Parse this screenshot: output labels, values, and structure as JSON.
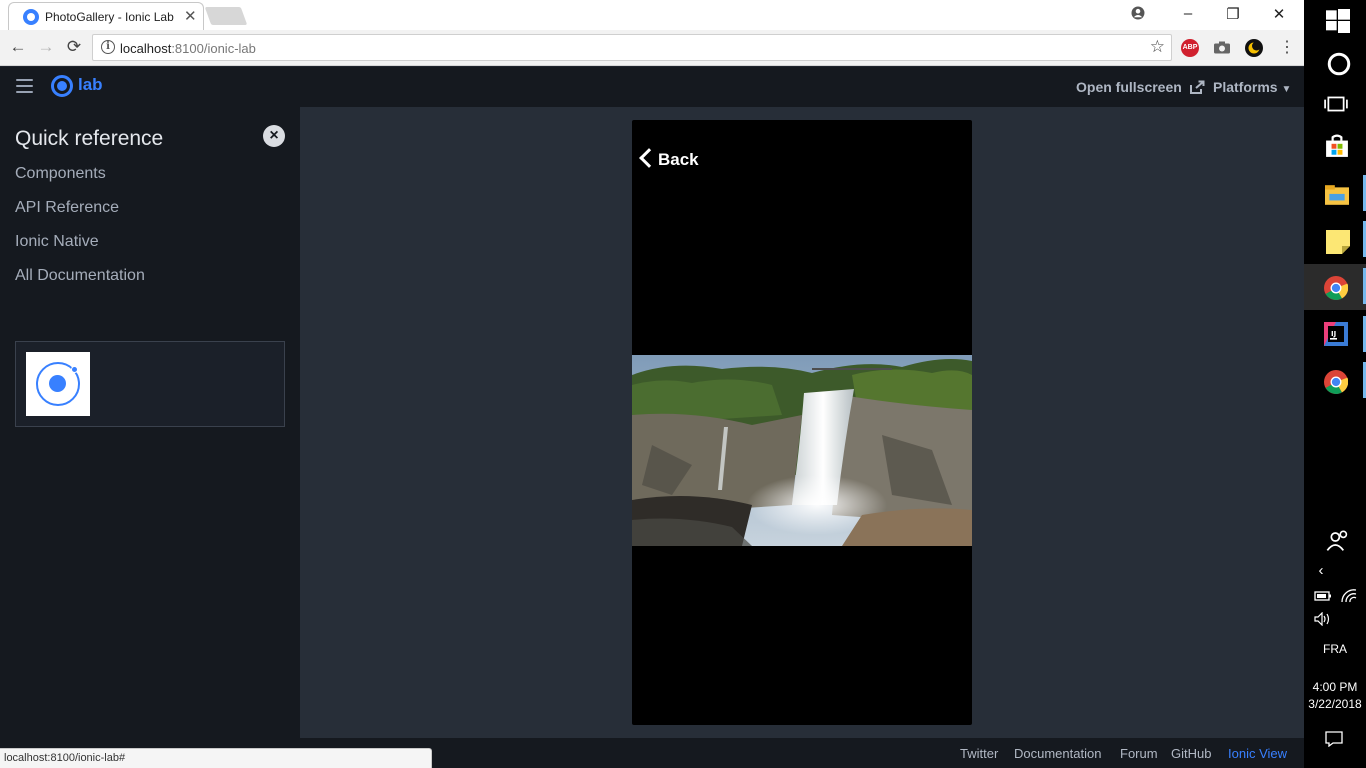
{
  "browser": {
    "tab_title": "PhotoGallery - Ionic Lab",
    "tab_close": "✕",
    "url_host": "localhost",
    "url_rest": ":8100/ionic-lab",
    "status_url": "localhost:8100/ionic-lab#",
    "extensions": [
      "ABP",
      "camera-icon",
      "moon-icon",
      "menu-icon"
    ]
  },
  "lab": {
    "logo_text": "lab",
    "open_fullscreen": "Open fullscreen",
    "platforms": "Platforms",
    "accent_color": "#3880ff"
  },
  "sidebar": {
    "title": "Quick reference",
    "links": [
      "Components",
      "API Reference",
      "Ionic Native",
      "All Documentation"
    ]
  },
  "device": {
    "back_label": "Back"
  },
  "footer": {
    "links": [
      "Twitter",
      "Documentation",
      "Forum",
      "GitHub",
      "Ionic View"
    ],
    "active": "Ionic View"
  },
  "taskbar": {
    "language": "FRA",
    "time": "4:00 PM",
    "date": "3/22/2018"
  }
}
